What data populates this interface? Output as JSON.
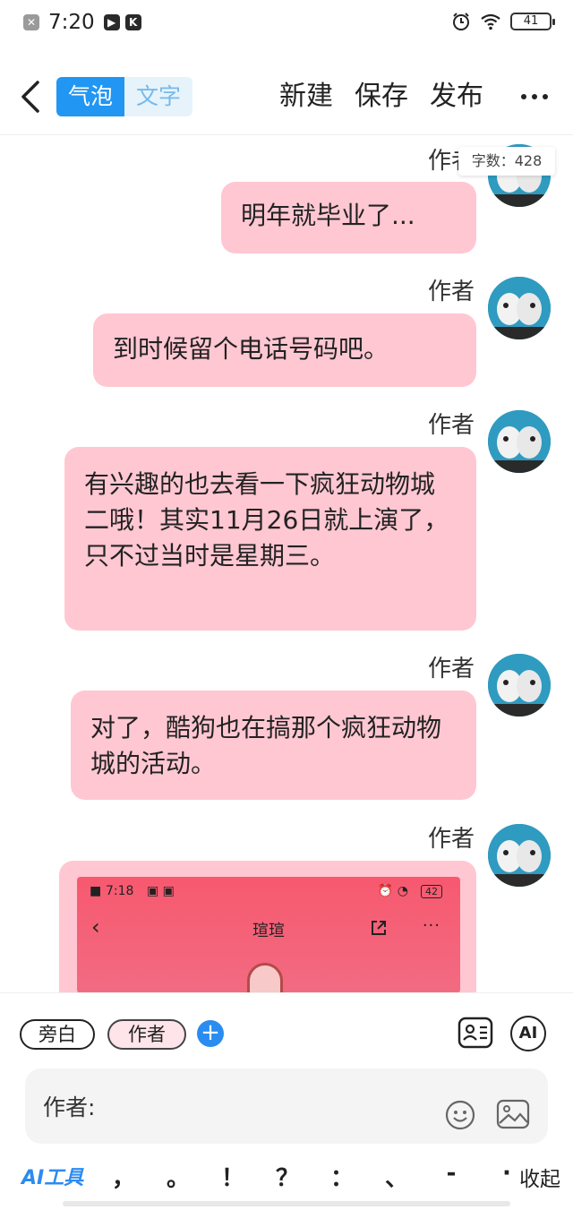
{
  "status_bar": {
    "time": "7:20",
    "battery": "41"
  },
  "toolbar": {
    "mode_bubble": "气泡",
    "mode_text": "文字",
    "new_label": "新建",
    "save_label": "保存",
    "publish_label": "发布"
  },
  "word_count": "字数：428",
  "messages": [
    {
      "author": "作者",
      "text": "明年就毕业了..."
    },
    {
      "author": "作者",
      "text": "到时候留个电话号码吧。"
    },
    {
      "author": "作者",
      "text": "有兴趣的也去看一下疯狂动物城二哦！其实11月26日就上演了，只不过当时是星期三。"
    },
    {
      "author": "作者",
      "text": "对了，酷狗也在搞那个疯狂动物城的活动。"
    },
    {
      "author": "作者",
      "image": {
        "status_time": "7:18",
        "battery": "42",
        "title": "瑄瑄"
      }
    }
  ],
  "panel": {
    "role_narrator": "旁白",
    "role_author": "作者",
    "ai_label": "AI",
    "input_label": "作者:",
    "ai_tools": "AI工具",
    "punctuation": [
      "，",
      "。",
      "！",
      "？",
      "：",
      "、",
      "-",
      "·"
    ],
    "collapse": "收起"
  }
}
